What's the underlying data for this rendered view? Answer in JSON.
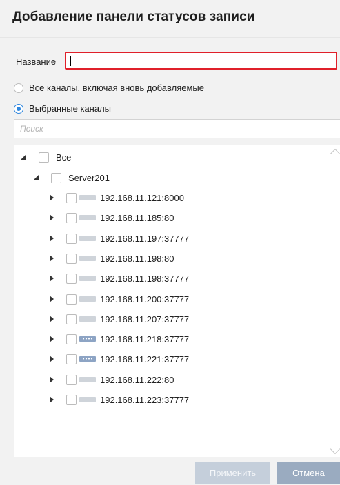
{
  "dialog": {
    "title": "Добавление панели статусов записи"
  },
  "form": {
    "name_label": "Название",
    "name_value": ""
  },
  "radios": [
    {
      "label": "Все каналы, включая вновь добавляемые",
      "checked": false
    },
    {
      "label": "Выбранные каналы",
      "checked": true
    }
  ],
  "search": {
    "placeholder": "Поиск"
  },
  "tree": {
    "root": {
      "label": "Все",
      "expanded": true,
      "checked": false
    },
    "server": {
      "label": "Server201",
      "expanded": true,
      "checked": false
    },
    "devices": [
      {
        "label": "192.168.11.121:8000",
        "icon": "camera-icon",
        "checked": false
      },
      {
        "label": "192.168.11.185:80",
        "icon": "camera-icon",
        "checked": false
      },
      {
        "label": "192.168.11.197:37777",
        "icon": "camera-icon",
        "checked": false
      },
      {
        "label": "192.168.11.198:80",
        "icon": "camera-icon",
        "checked": false
      },
      {
        "label": "192.168.11.198:37777",
        "icon": "camera-icon",
        "checked": false
      },
      {
        "label": "192.168.11.200:37777",
        "icon": "camera-icon",
        "checked": false
      },
      {
        "label": "192.168.11.207:37777",
        "icon": "camera-icon",
        "checked": false
      },
      {
        "label": "192.168.11.218:37777",
        "icon": "nvr-icon",
        "checked": false
      },
      {
        "label": "192.168.11.221:37777",
        "icon": "nvr-icon",
        "checked": false
      },
      {
        "label": "192.168.11.222:80",
        "icon": "camera-icon",
        "checked": false
      },
      {
        "label": "192.168.11.223:37777",
        "icon": "camera-icon",
        "checked": false
      }
    ]
  },
  "buttons": {
    "apply": "Применить",
    "cancel": "Отмена"
  },
  "colors": {
    "accent": "#2e86de",
    "error_border": "#e0202a",
    "apply_disabled": "#c5cfdb",
    "cancel": "#9aabc0"
  }
}
